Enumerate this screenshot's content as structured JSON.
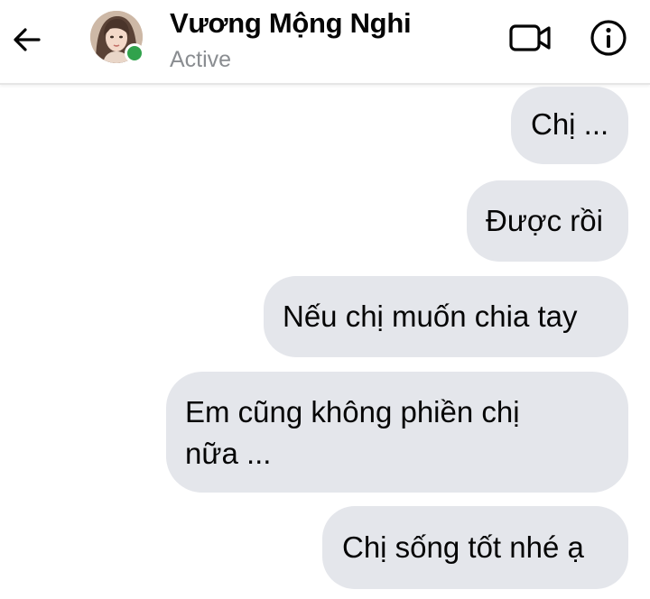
{
  "header": {
    "contact_name": "Vương Mộng Nghi",
    "status": "Active",
    "icons": {
      "back": "arrow-left-icon",
      "video": "video-call-icon",
      "info": "info-icon"
    },
    "online_color": "#31a24c"
  },
  "messages": [
    {
      "text": "Chị ..."
    },
    {
      "text": "Được rồi"
    },
    {
      "text": "Nếu chị muốn chia tay"
    },
    {
      "lines": [
        "Em cũng không phiền chị",
        "nữa ..."
      ]
    },
    {
      "text": "Chị sống tốt nhé ạ"
    }
  ],
  "colors": {
    "bubble_bg": "#e4e6eb",
    "text": "#050505",
    "muted": "#8a8d91"
  }
}
